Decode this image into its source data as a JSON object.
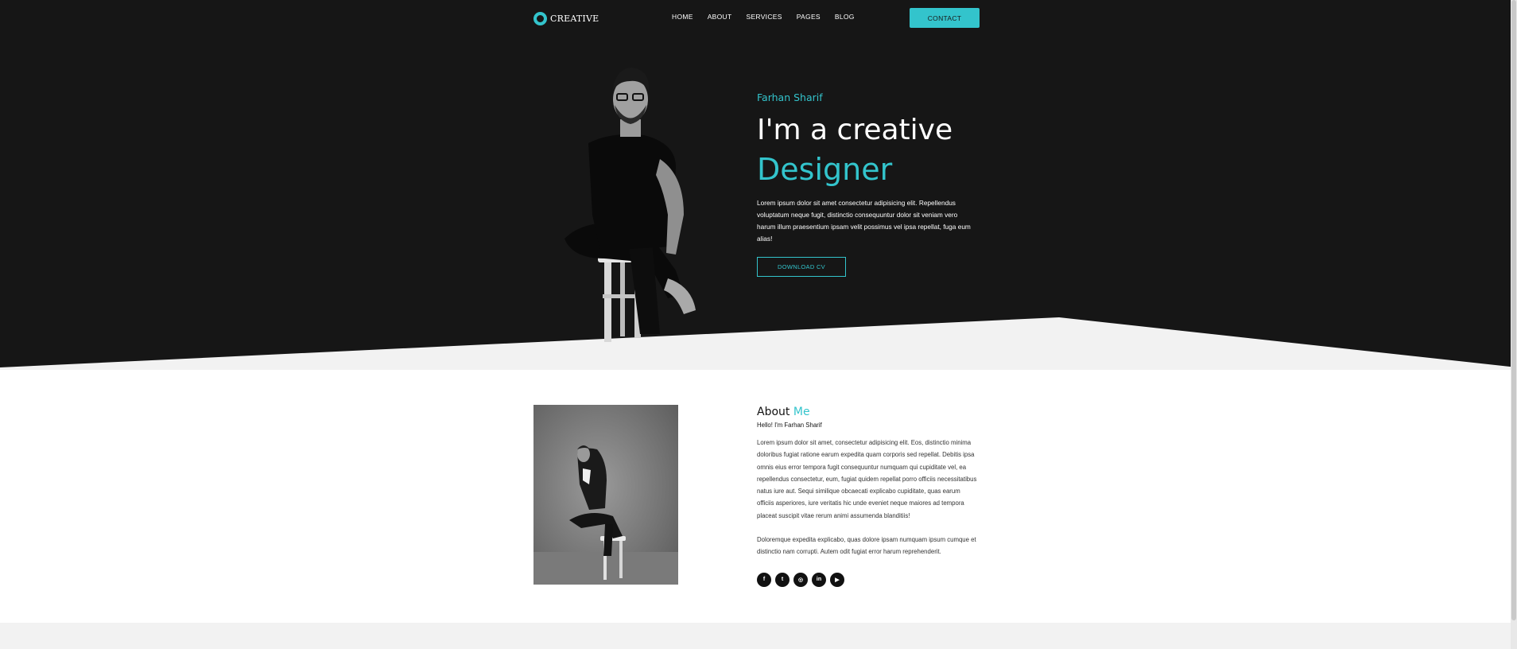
{
  "colors": {
    "accent": "#33c4cc",
    "dark": "#161616",
    "white": "#ffffff",
    "footer": "#f2f2f2"
  },
  "nav": {
    "logo_text": "CREATIVE",
    "links": [
      "HOME",
      "ABOUT",
      "SERVICES",
      "PAGES",
      "BLOG"
    ],
    "contact": "CONTACT"
  },
  "hero": {
    "name": "Farhan Sharif",
    "title_line1": "I'm a creative",
    "title_line2": "Designer",
    "description": "Lorem ipsum dolor sit amet consectetur adipisicing elit. Repellendus voluptatum neque fugit, distinctio consequuntur dolor sit veniam vero harum illum praesentium ipsam velit possimus vel ipsa repellat, fuga eum alias!",
    "button": "DOWNLOAD CV"
  },
  "about": {
    "heading_main": "About",
    "heading_accent": "Me",
    "hello": "Hello! I'm Farhan Sharif",
    "paragraph1": "Lorem ipsum dolor sit amet, consectetur adipisicing elit. Eos, distinctio minima doloribus fugiat ratione earum expedita quam corporis sed repellat. Debitis ipsa omnis eius error tempora fugit consequuntur numquam qui cupiditate vel, ea repellendus consectetur, eum, fugiat quidem repellat porro officiis necessitatibus natus iure aut. Sequi similique obcaecati explicabo cupiditate, quas earum officiis asperiores, iure veritatis hic unde eveniet neque maiores ad tempora placeat suscipit vitae rerum animi assumenda blanditiis!",
    "paragraph2": "Doloremque expedita explicabo, quas dolore ipsam numquam ipsum cumque et distinctio nam corrupti. Autem odit fugiat error harum reprehenderit.",
    "socials": [
      {
        "icon": "facebook-icon",
        "glyph": "f"
      },
      {
        "icon": "twitter-icon",
        "glyph": "t"
      },
      {
        "icon": "instagram-icon",
        "glyph": "◎"
      },
      {
        "icon": "linkedin-icon",
        "glyph": "in"
      },
      {
        "icon": "youtube-icon",
        "glyph": "▶"
      }
    ]
  }
}
